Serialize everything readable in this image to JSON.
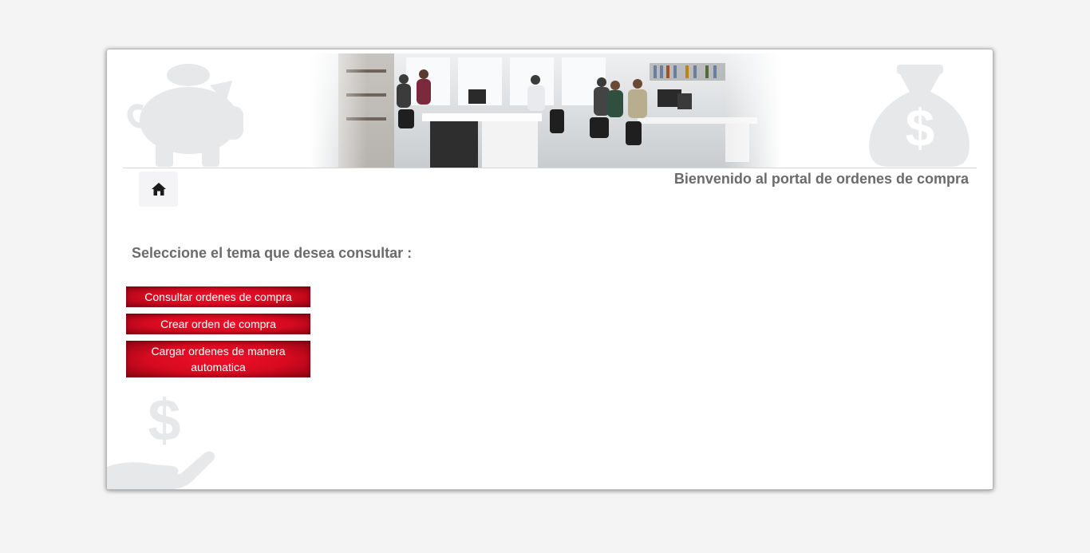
{
  "header": {
    "welcome_text": "Bienvenido al portal de ordenes de compra"
  },
  "nav": {
    "home_icon": "home-icon"
  },
  "main": {
    "prompt": "Seleccione el tema que desea consultar :",
    "options": [
      {
        "label": "Consultar ordenes de compra"
      },
      {
        "label": "Crear orden de compra"
      },
      {
        "label": "Cargar ordenes de manera automatica"
      }
    ]
  },
  "decor": {
    "icons": [
      "piggy-bank-icon",
      "money-bag-icon",
      "hand-coin-icon"
    ]
  },
  "colors": {
    "button_red": "#d50a20",
    "button_dark": "#8e0413",
    "text_gray": "#6b6b6b",
    "icon_gray": "#e6e8e9",
    "background": "#f4f4f4"
  }
}
